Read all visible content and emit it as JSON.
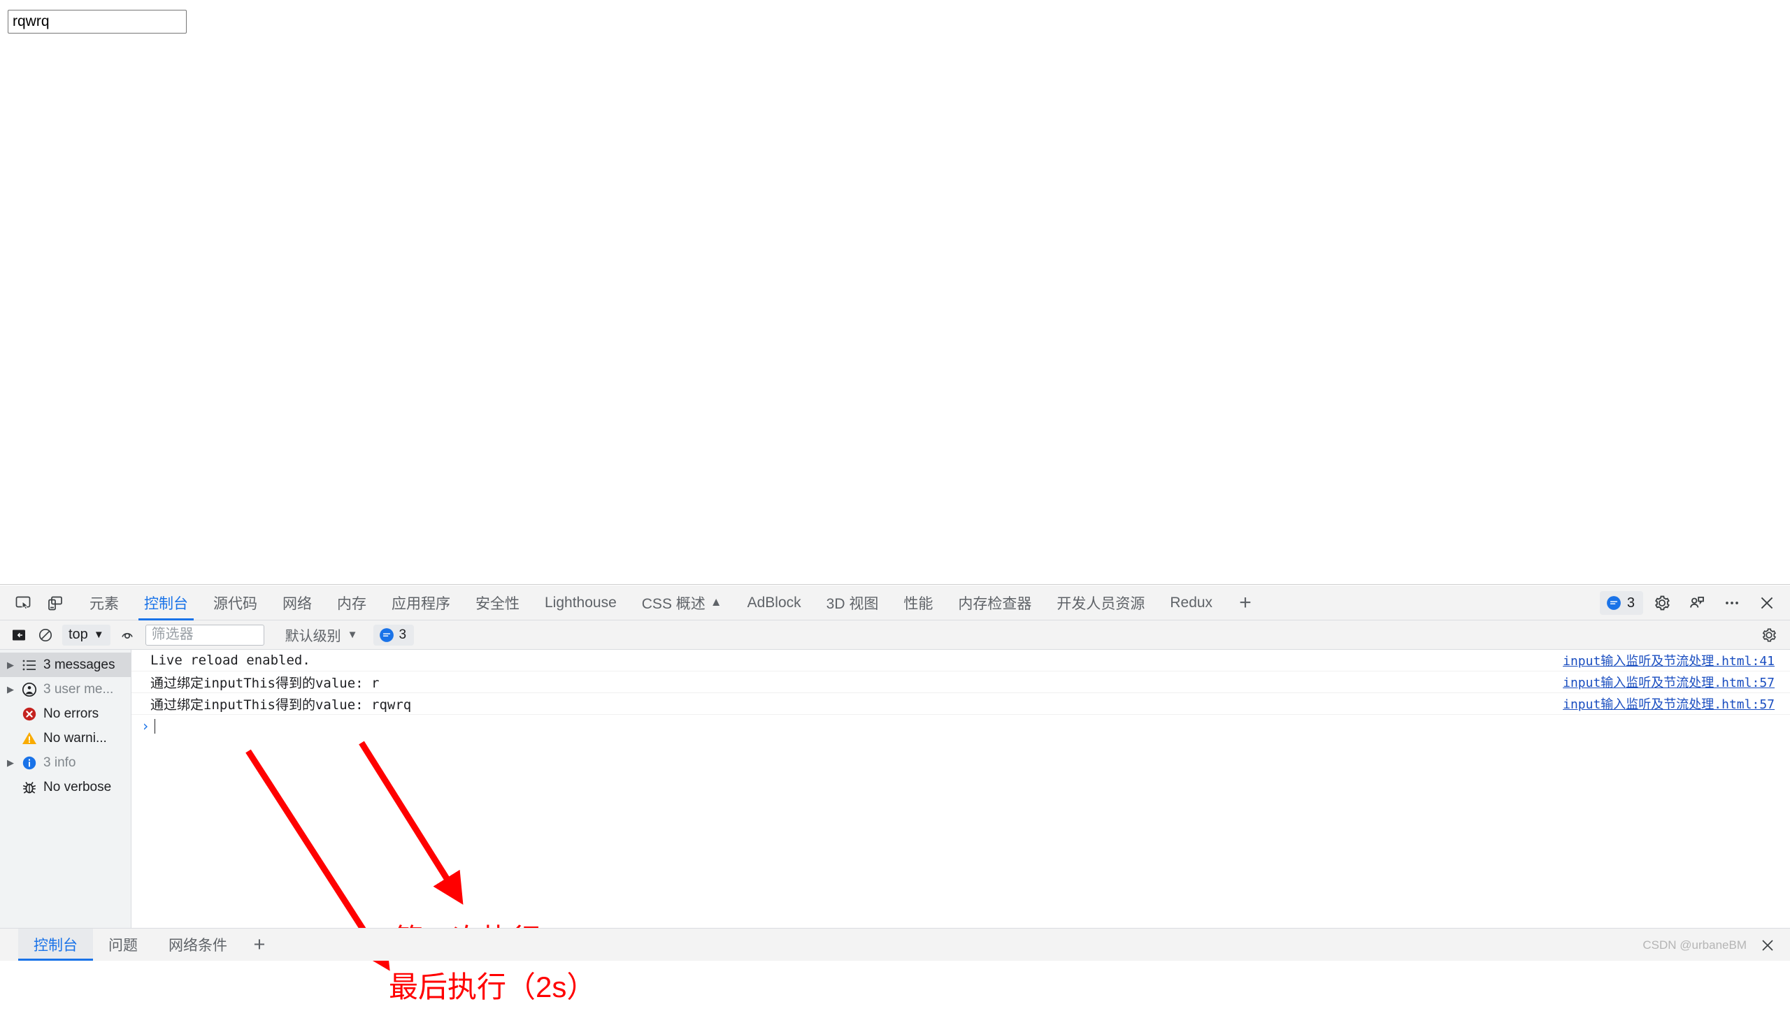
{
  "page": {
    "input_value": "rqwrq",
    "input_placeholder": ""
  },
  "devtools": {
    "toolbar_icons": {
      "inspect": "inspect-element-icon",
      "device": "device-toolbar-icon"
    },
    "tabs": [
      {
        "label": "元素",
        "selected": false
      },
      {
        "label": "控制台",
        "selected": true
      },
      {
        "label": "源代码",
        "selected": false
      },
      {
        "label": "网络",
        "selected": false
      },
      {
        "label": "内存",
        "selected": false
      },
      {
        "label": "应用程序",
        "selected": false
      },
      {
        "label": "安全性",
        "selected": false
      },
      {
        "label": "Lighthouse",
        "selected": false
      },
      {
        "label": "CSS 概述",
        "selected": false,
        "flask": "▲"
      },
      {
        "label": "AdBlock",
        "selected": false
      },
      {
        "label": "3D 视图",
        "selected": false
      },
      {
        "label": "性能",
        "selected": false
      },
      {
        "label": "内存检查器",
        "selected": false
      },
      {
        "label": "开发人员资源",
        "selected": false
      },
      {
        "label": "Redux",
        "selected": false
      }
    ],
    "add_tab_label": "+",
    "message_badge_count": "3",
    "right_icons": {
      "settings": "gear-icon",
      "customize": "devtools-layout-icon",
      "more": "more-options-icon",
      "close": "close-icon"
    },
    "console_toolbar": {
      "sidebar_toggle": "console-sidebar-toggle-icon",
      "clear": "clear-console-icon",
      "context": "top",
      "eye": "live-expression-icon",
      "filter_placeholder": "筛选器",
      "filter_value": "",
      "level_label": "默认级别",
      "issues_count": "3",
      "settings": "gear-icon"
    },
    "sidebar": [
      {
        "label": "3 messages",
        "icon": "list-icon",
        "expandable": true,
        "active": true,
        "muted": false
      },
      {
        "label": "3 user me...",
        "icon": "user-message-icon",
        "expandable": true,
        "active": false,
        "muted": true
      },
      {
        "label": "No errors",
        "icon": "error-icon",
        "expandable": false,
        "active": false,
        "muted": false
      },
      {
        "label": "No warni...",
        "icon": "warning-icon",
        "expandable": false,
        "active": false,
        "muted": false
      },
      {
        "label": "3 info",
        "icon": "info-icon",
        "expandable": true,
        "active": false,
        "muted": true
      },
      {
        "label": "No verbose",
        "icon": "verbose-bug-icon",
        "expandable": false,
        "active": false,
        "muted": false
      }
    ],
    "messages": [
      {
        "text": "Live reload enabled.",
        "source": "input输入监听及节流处理.html:41"
      },
      {
        "text": "通过绑定inputThis得到的value: r",
        "source": "input输入监听及节流处理.html:57"
      },
      {
        "text": "通过绑定inputThis得到的value: rqwrq",
        "source": "input输入监听及节流处理.html:57"
      }
    ],
    "prompt": {
      "caret": "›",
      "value": ""
    },
    "drawer_tabs": [
      {
        "label": "控制台",
        "selected": true
      },
      {
        "label": "问题",
        "selected": false
      },
      {
        "label": "网络条件",
        "selected": false
      }
    ],
    "drawer_add_label": "+",
    "drawer_close": "close-icon"
  },
  "annotations": [
    {
      "name": "first-execution",
      "text": "第一次执行"
    },
    {
      "name": "last-execution",
      "text": "最后执行（2s）"
    }
  ],
  "watermark": "CSDN @urbaneBM",
  "colors": {
    "accent": "#1a73e8",
    "annotation_red": "#ff0000",
    "link": "#1a4ec0",
    "toolbar_bg": "#f3f3f3",
    "sidebar_bg": "#f1f3f4",
    "error": "#c5221f",
    "warning": "#f9ab00",
    "info": "#1a73e8"
  }
}
